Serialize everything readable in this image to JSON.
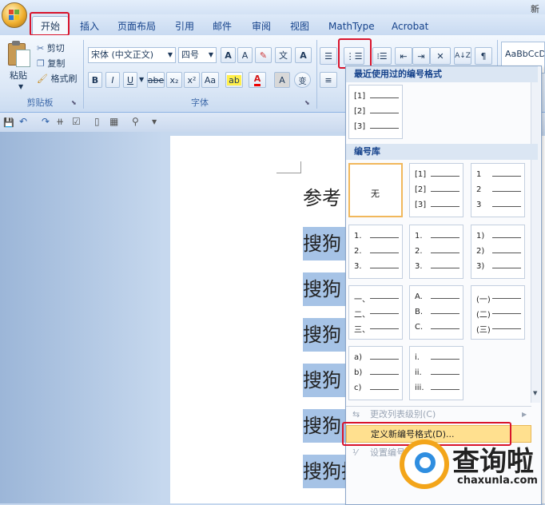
{
  "window": {
    "title_fragment": "新建"
  },
  "tabs": [
    "开始",
    "插入",
    "页面布局",
    "引用",
    "邮件",
    "审阅",
    "视图",
    "MathType",
    "Acrobat"
  ],
  "clipboard": {
    "paste": "粘贴",
    "cut": "剪切",
    "copy": "复制",
    "format_painter": "格式刷",
    "group": "剪贴板"
  },
  "font": {
    "name": "宋体 (中文正文)",
    "size": "四号",
    "group": "字体",
    "bold": "B",
    "italic": "I",
    "underline": "U",
    "strike": "abe",
    "sub": "x₂",
    "sup": "x²",
    "aa": "Aa",
    "A": "A",
    "style_preview": "AaBbCcDc",
    "wen": "文",
    "changing": "变"
  },
  "document": {
    "heading": "参考",
    "lines": [
      "搜狗",
      "搜狗",
      "搜狗",
      "搜狗",
      "搜狗",
      "搜狗指南"
    ]
  },
  "menu": {
    "recent_title": "最近使用过的编号格式",
    "recent": [
      "[1]",
      "[2]",
      "[3]"
    ],
    "library_title": "编号库",
    "none_label": "无",
    "styles": [
      [
        "[1]",
        "[2]",
        "[3]"
      ],
      [
        "1",
        "2",
        "3"
      ],
      [
        "1.",
        "2.",
        "3."
      ],
      [
        "1.",
        "2.",
        "3."
      ],
      [
        "1)",
        "2)",
        "3)"
      ],
      [
        "一、",
        "二、",
        "三、"
      ],
      [
        "A.",
        "B.",
        "C."
      ],
      [
        "(一)",
        "(二)",
        "(三)"
      ],
      [
        "a)",
        "b)",
        "c)"
      ],
      [
        "i.",
        "ii.",
        "iii."
      ]
    ],
    "change_level": "更改列表级别(C)",
    "define_new": "定义新编号格式(D)...",
    "set_value": "设置编号值"
  },
  "watermark": {
    "brand": "查询啦",
    "url": "chaxunla.com"
  }
}
